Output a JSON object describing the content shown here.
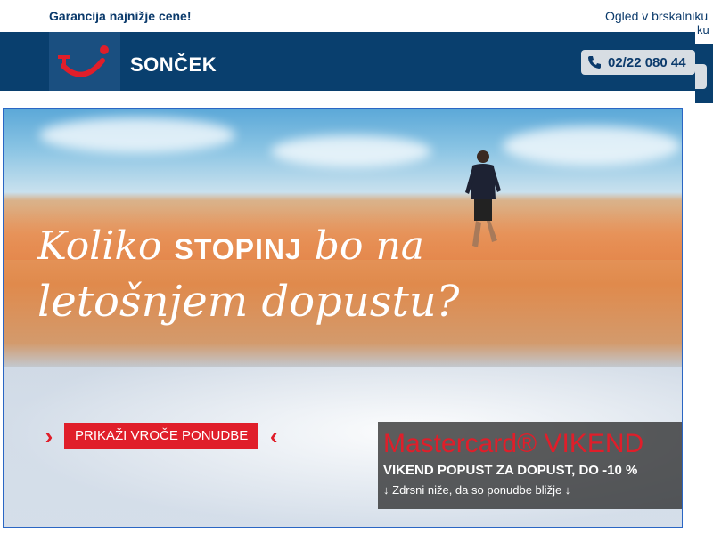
{
  "topbar": {
    "slogan": "Garancija najnižje cene!",
    "browser_link": "Ogled v brskalniku",
    "overflow_text": "ku"
  },
  "header": {
    "brand": "SONČEK",
    "phone": "02/22 080 44"
  },
  "hero": {
    "headline_part1": "Koliko ",
    "headline_strong": "STOPINJ",
    "headline_part2": " bo na",
    "headline_line2": "letošnjem dopustu?",
    "cta_label": "PRIKAŽI VROČE PONUDBE",
    "promo_title": "Mastercard® VIKEND",
    "promo_subtitle": "VIKEND POPUST ZA DOPUST, DO -10 %",
    "promo_scroll": "Zdrsni niže, da so ponudbe bližje"
  },
  "colors": {
    "navy": "#093f6e",
    "accent_red": "#e01e2a"
  }
}
